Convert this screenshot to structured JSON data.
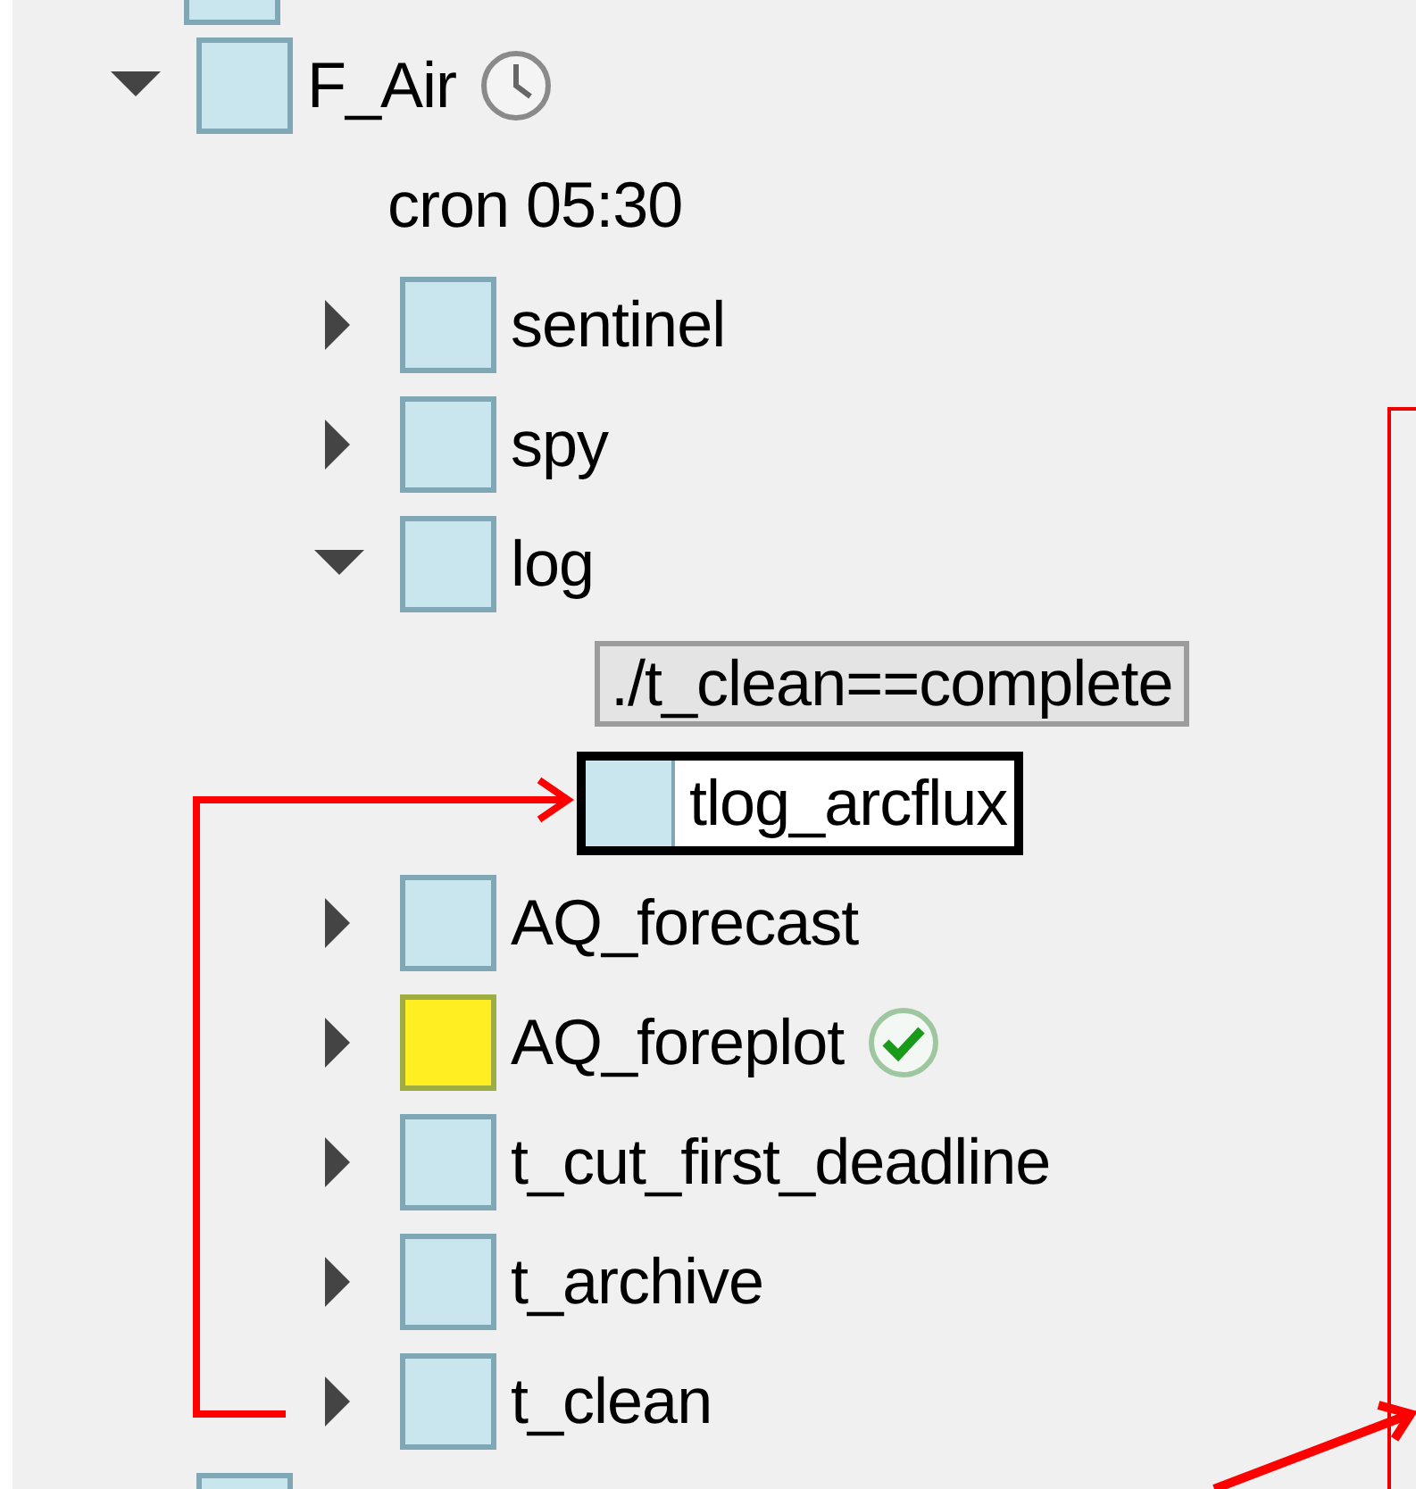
{
  "tree": [
    {
      "kind": "fragment",
      "color": "#c9e6ef"
    },
    {
      "kind": "node",
      "name": "F_Air",
      "color": "#c9e6ef",
      "timed": true,
      "done": false,
      "expanded": true,
      "selected": false,
      "children": [
        {
          "kind": "attribute",
          "text": "cron 05:30"
        },
        {
          "kind": "node",
          "name": "sentinel",
          "color": "#c9e6ef",
          "timed": false,
          "done": false,
          "expanded": false,
          "selected": false
        },
        {
          "kind": "node",
          "name": "spy",
          "color": "#c9e6ef",
          "timed": false,
          "done": false,
          "expanded": false,
          "selected": false
        },
        {
          "kind": "node",
          "name": "log",
          "color": "#c9e6ef",
          "timed": false,
          "done": false,
          "expanded": true,
          "selected": false,
          "children": [
            {
              "kind": "trigger",
              "text": "./t_clean==complete"
            },
            {
              "kind": "node",
              "name": "tlog_arcflux",
              "color": "#c9e6ef",
              "timed": false,
              "done": false,
              "selected": true
            }
          ]
        },
        {
          "kind": "node",
          "name": "AQ_forecast",
          "color": "#c9e6ef",
          "timed": false,
          "done": false,
          "expanded": false,
          "selected": false
        },
        {
          "kind": "node",
          "name": "AQ_foreplot",
          "color": "#ffee22",
          "timed": false,
          "done": true,
          "expanded": false,
          "selected": false
        },
        {
          "kind": "node",
          "name": "t_cut_first_deadline",
          "color": "#c9e6ef",
          "timed": false,
          "done": false,
          "expanded": false,
          "selected": false
        },
        {
          "kind": "node",
          "name": "t_archive",
          "color": "#c9e6ef",
          "timed": false,
          "done": false,
          "expanded": false,
          "selected": false
        },
        {
          "kind": "node",
          "name": "t_clean",
          "color": "#c9e6ef",
          "timed": false,
          "done": false,
          "expanded": false,
          "selected": false
        }
      ]
    },
    {
      "kind": "node",
      "color": "#c9e6ef"
    }
  ]
}
